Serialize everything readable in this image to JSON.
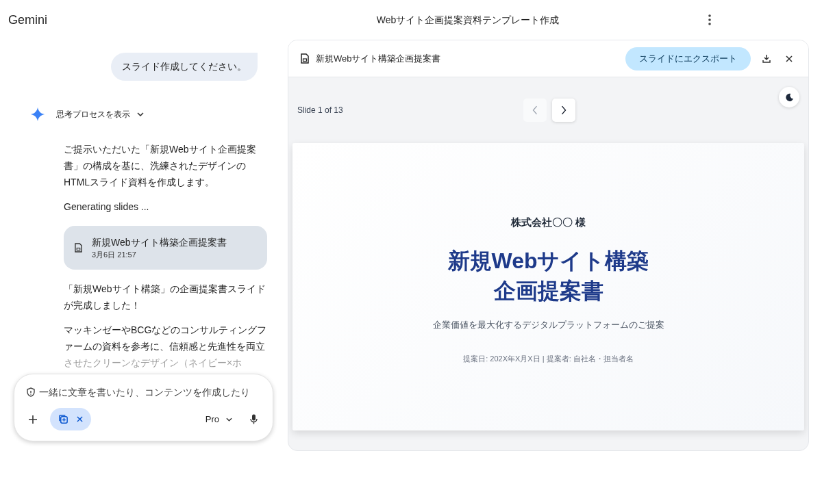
{
  "app": {
    "name": "Gemini"
  },
  "header": {
    "title": "Webサイト企画提案資料テンプレート作成"
  },
  "chat": {
    "user_message": "スライド作成してください。",
    "thinking_toggle": {
      "label": "思考プロセスを表示",
      "expanded": false
    },
    "response": [
      {
        "kind": "text",
        "text": "ご提示いただいた「新規Webサイト企画提案書」の構成を基に、洗練されたデザインのHTMLスライド資料を作成します。"
      },
      {
        "kind": "text",
        "text": "Generating slides ..."
      },
      {
        "kind": "file",
        "title": "新規Webサイト構築企画提案書",
        "date": "3月6日 21:57"
      },
      {
        "kind": "text",
        "text": "「新規Webサイト構築」の企画提案書スライドが完成しました！"
      },
      {
        "kind": "text",
        "text": "マッキンゼーやBCGなどのコンサルティングファームの資料を参考に、信頼感と先進性を両立させたクリーンなデザイン（ネイビー×ホ"
      }
    ]
  },
  "input": {
    "placeholder": "一緒に文章を書いたり、コンテンツを作成したり",
    "model": "Pro"
  },
  "canvas": {
    "doc_title": "新規Webサイト構築企画提案書",
    "export_button": "スライドにエクスポート",
    "slide_counter": "Slide 1 of 13",
    "nav": [
      {
        "kind": "previous",
        "disabled": true
      },
      {
        "kind": "next",
        "disabled": false
      }
    ],
    "slide": {
      "client": "株式会社〇〇 様",
      "title_lines": [
        "新規Webサイト構築",
        "企画提案書"
      ],
      "subtitle": "企業価値を最大化するデジタルプラットフォームのご提案",
      "meta": "提案日: 202X年X月X日 | 提案者: 自社名・担当者名"
    }
  }
}
